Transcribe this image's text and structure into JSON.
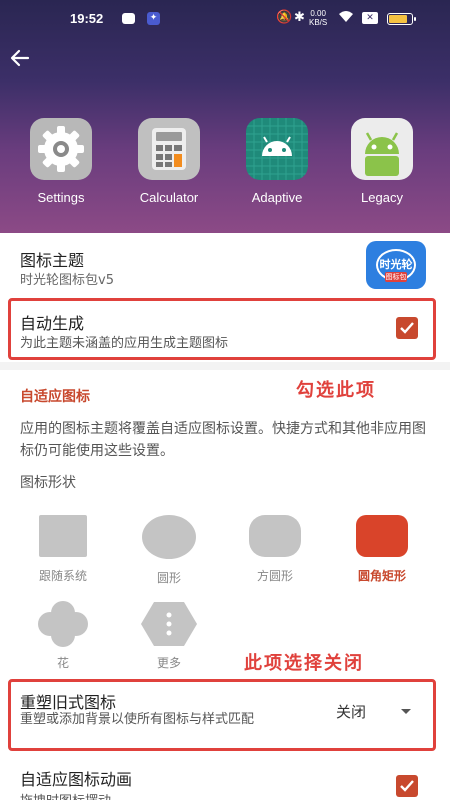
{
  "status_bar": {
    "time": "19:52",
    "speed_top": "0.00",
    "speed_bottom": "KB/S",
    "battery_level": 0.85
  },
  "preview_icons": [
    {
      "label": "Settings",
      "icon": "gear-icon"
    },
    {
      "label": "Calculator",
      "icon": "calculator-icon"
    },
    {
      "label": "Adaptive",
      "icon": "android-icon"
    },
    {
      "label": "Legacy",
      "icon": "android-legacy-icon"
    }
  ],
  "icon_theme": {
    "title": "图标主题",
    "subtitle": "时光轮图标包v5",
    "app_icon_text_top": "时光轮",
    "app_icon_text_bottom": "图标包"
  },
  "auto_generate": {
    "title": "自动生成",
    "subtitle": "为此主题未涵盖的应用生成主题图标",
    "checked": true
  },
  "annotations": {
    "check_this": "勾选此项",
    "select_off": "此项选择关闭"
  },
  "adaptive_section": {
    "header": "自适应图标",
    "description": "应用的图标主题将覆盖自适应图标设置。快捷方式和其他非应用图标仍可能使用这些设置。",
    "shape_title": "图标形状",
    "shapes": [
      {
        "label": "跟随系统",
        "selected": false
      },
      {
        "label": "圆形",
        "selected": false
      },
      {
        "label": "方圆形",
        "selected": false
      },
      {
        "label": "圆角矩形",
        "selected": true
      },
      {
        "label": "花",
        "selected": false
      },
      {
        "label": "更多",
        "selected": false
      }
    ]
  },
  "reshape_legacy": {
    "title": "重塑旧式图标",
    "subtitle": "重塑或添加背景以使所有图标与样式匹配",
    "value": "关闭"
  },
  "adaptive_animation": {
    "title": "自适应图标动画",
    "subtitle": "拖拽时图标摆动",
    "checked": true
  },
  "colors": {
    "accent": "#c8492e",
    "annotation_red": "#e0413c"
  }
}
